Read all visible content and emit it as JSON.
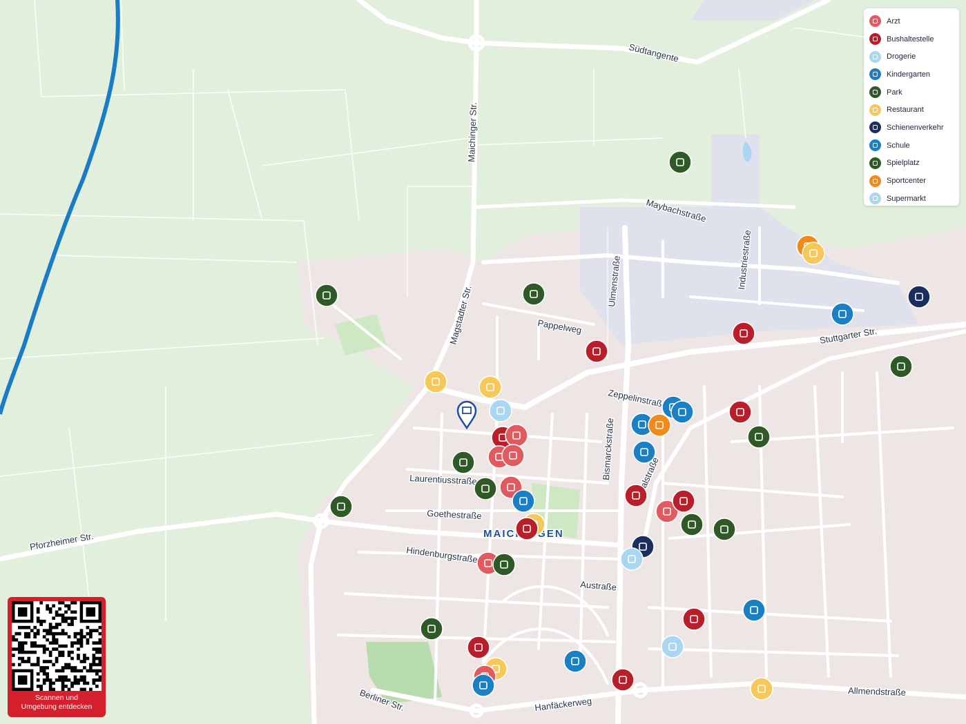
{
  "streets": {
    "suedtangente": "Südtangente",
    "maichinger": "Maichinger Str.",
    "magstadter": "Magstadter Str.",
    "maybach": "Maybachstraße",
    "ulmen": "Ulmenstraße",
    "industrie": "Industriestraße",
    "pappelweg": "Pappelweg",
    "stuttgarter": "Stuttgarter Str.",
    "zeppelin": "Zeppelinstraße",
    "bismarck": "Bismarckstraße",
    "bahnhof_partial": "alstraße",
    "laurentius": "Laurentiusstraße",
    "goethe": "Goethestraße",
    "pforzheimer": "Pforzheimer Str.",
    "hindenburg": "Hindenburgstraße",
    "austrasse": "Austraße",
    "berliner": "Berliner Str.",
    "hanfaecker": "Hanfäckerweg",
    "allmend": "Allmendstraße"
  },
  "town_label": "MAICHINGEN",
  "legend": [
    {
      "label": "Arzt",
      "color": "#e05a5f",
      "icon": "doctor-icon"
    },
    {
      "label": "Bushaltestelle",
      "color": "#b81f2a",
      "icon": "bus-icon"
    },
    {
      "label": "Drogerie",
      "color": "#a9d7f2",
      "icon": "drugstore-icon"
    },
    {
      "label": "Kindergarten",
      "color": "#1b7fc4",
      "icon": "kindergarten-icon"
    },
    {
      "label": "Park",
      "color": "#2f5a28",
      "icon": "park-icon"
    },
    {
      "label": "Restaurant",
      "color": "#f6c85a",
      "icon": "restaurant-icon"
    },
    {
      "label": "Schienenverkehr",
      "color": "#1b2e5e",
      "icon": "train-icon"
    },
    {
      "label": "Schule",
      "color": "#1b7fc4",
      "icon": "school-icon"
    },
    {
      "label": "Spielplatz",
      "color": "#2f5a28",
      "icon": "playground-icon"
    },
    {
      "label": "Sportcenter",
      "color": "#f08a1a",
      "icon": "sportcenter-icon"
    },
    {
      "label": "Supermarkt",
      "color": "#a9d7f2",
      "icon": "supermarket-icon"
    }
  ],
  "qr": {
    "caption_line1": "Scannen und",
    "caption_line2": "Umgebung entdecken"
  },
  "colors": {
    "location_pin": "#1f4e9e",
    "railway": "#1a7cc6"
  }
}
